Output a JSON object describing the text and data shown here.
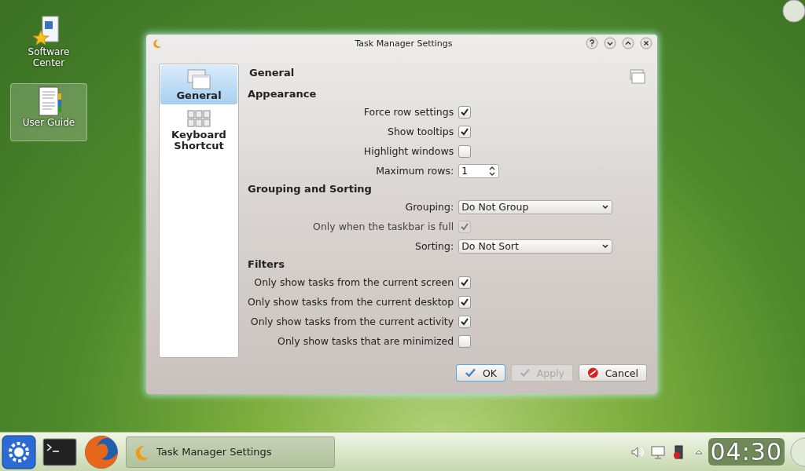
{
  "desktop_icons": [
    {
      "kind": "package",
      "label": "Software Center",
      "selected": false
    },
    {
      "kind": "book",
      "label": "User Guide",
      "selected": true
    }
  ],
  "window": {
    "title": "Task Manager Settings"
  },
  "sidebar": {
    "items": [
      {
        "kind": "windows",
        "label": "General",
        "selected": true
      },
      {
        "kind": "keyboard",
        "label": "Keyboard Shortcut",
        "selected": false
      }
    ]
  },
  "page_title": "General",
  "sections": [
    {
      "title": "Appearance",
      "rows": [
        {
          "kind": "checkbox",
          "label": "Force row settings",
          "checked": true,
          "disabled": false
        },
        {
          "kind": "checkbox",
          "label": "Show tooltips",
          "checked": true,
          "disabled": false
        },
        {
          "kind": "checkbox",
          "label": "Highlight windows",
          "checked": false,
          "disabled": false
        },
        {
          "kind": "spin",
          "label": "Maximum rows:",
          "value": "1"
        }
      ]
    },
    {
      "title": "Grouping and Sorting",
      "rows": [
        {
          "kind": "combo",
          "label": "Grouping:",
          "value": "Do Not Group"
        },
        {
          "kind": "checkbox",
          "label": "Only when the taskbar is full",
          "checked": true,
          "disabled": true
        },
        {
          "kind": "combo",
          "label": "Sorting:",
          "value": "Do Not Sort"
        }
      ]
    },
    {
      "title": "Filters",
      "rows": [
        {
          "kind": "checkbox",
          "label": "Only show tasks from the current screen",
          "checked": true,
          "disabled": false
        },
        {
          "kind": "checkbox",
          "label": "Only show tasks from the current desktop",
          "checked": true,
          "disabled": false
        },
        {
          "kind": "checkbox",
          "label": "Only show tasks from the current activity",
          "checked": true,
          "disabled": false
        },
        {
          "kind": "checkbox",
          "label": "Only show tasks that are minimized",
          "checked": false,
          "disabled": false
        }
      ]
    }
  ],
  "buttons": [
    {
      "kind": "ok",
      "label": "OK",
      "disabled": false
    },
    {
      "kind": "ok",
      "label": "Apply",
      "disabled": true
    },
    {
      "kind": "cancel",
      "label": "Cancel",
      "disabled": false
    }
  ],
  "taskbar": {
    "tasks": [
      {
        "label": "Task Manager Settings"
      }
    ],
    "clock": "04:30"
  }
}
